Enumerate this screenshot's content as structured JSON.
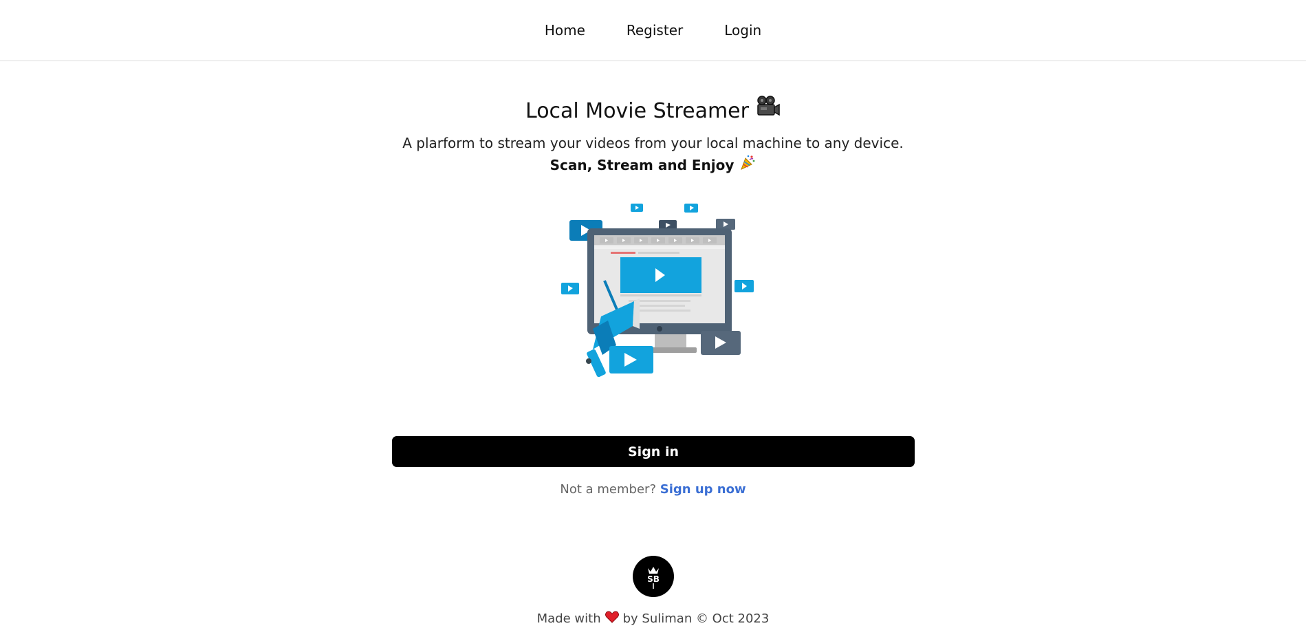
{
  "nav": {
    "items": [
      {
        "label": "Home"
      },
      {
        "label": "Register"
      },
      {
        "label": "Login"
      }
    ]
  },
  "hero": {
    "title": "Local Movie Streamer",
    "title_icon": "movie-camera-icon",
    "subtitle": "A plarform to stream your videos from your local machine to any device.",
    "tagline": "Scan, Stream and Enjoy",
    "tagline_icon": "party-popper-icon"
  },
  "auth": {
    "signin_label": "Sign in",
    "not_member_text": "Not a member?",
    "signup_label": "Sign up now"
  },
  "footer": {
    "logo_text": "SB",
    "made_with": "Made with",
    "heart_icon": "heart-icon",
    "byline": "by Suliman © Oct 2023"
  },
  "colors": {
    "accent_link": "#3b6fd4",
    "button_bg": "#000000",
    "illustration_blue": "#12a3dd",
    "illustration_slate": "#4f6275"
  }
}
